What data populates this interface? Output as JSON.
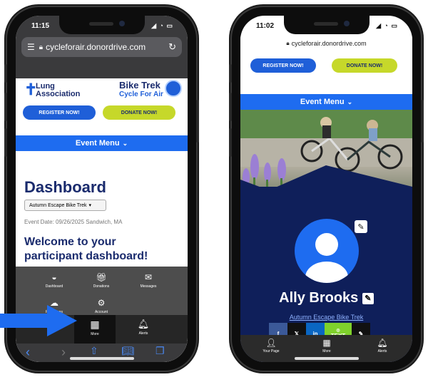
{
  "left_phone": {
    "status": {
      "time": "11:15",
      "icons": "▲ ◆ ▭"
    },
    "address_bar": {
      "host": "cycleforair.donordrive.com",
      "tab_icon": "tabs-icon",
      "reload_icon": "reload-icon"
    },
    "logo_left": {
      "line1": "Lung",
      "line2": "Association"
    },
    "logo_right": {
      "title": "Bike Trek",
      "subtitle": "Cycle For Air"
    },
    "buttons": {
      "register": "REGISTER NOW!",
      "donate": "DONATE NOW!"
    },
    "event_menu": "Event Menu",
    "dashboard": {
      "title": "Dashboard",
      "event_select": "Autumn Escape Bike Trek",
      "date_line": "Event Date: 09/26/2025  Sandwich, MA",
      "welcome": "Welcome to your participant dashboard!"
    },
    "more_menu": [
      {
        "label": "Dashboard",
        "icon": "speedometer-icon"
      },
      {
        "label": "Donations",
        "icon": "gift-icon"
      },
      {
        "label": "Messages",
        "icon": "envelope-icon"
      },
      {
        "label": "Resources",
        "icon": "cloud-icon"
      },
      {
        "label": "Account",
        "icon": "gear-icon"
      }
    ],
    "tab_more": "More",
    "tab_alerts": "Alerts"
  },
  "right_phone": {
    "status": {
      "time": "11:02"
    },
    "address": "cycleforair.donordrive.com",
    "buttons": {
      "register": "REGISTER NOW!",
      "donate": "DONATE NOW!"
    },
    "event_menu": "Event Menu",
    "profile_name": "Ally Brooks",
    "event_link": "Autumn Escape Bike Trek",
    "share": [
      {
        "label": "f",
        "color": "#3b5998"
      },
      {
        "label": "𝕏",
        "color": "#111111"
      },
      {
        "label": "in",
        "color": "#0a66c2"
      },
      {
        "label": "TEXT",
        "color": "#7fd12c"
      },
      {
        "label": "✎",
        "color": "#111111"
      }
    ],
    "tabs": [
      {
        "label": "Your Page",
        "icon": "person-icon"
      },
      {
        "label": "More",
        "icon": "grid-icon"
      },
      {
        "label": "Alerts",
        "icon": "bell-icon"
      }
    ]
  },
  "colors": {
    "brand_blue": "#1e6cf0",
    "navy": "#0f1f5a",
    "lime": "#c6d82a",
    "callout_arrow": "#1e6cf0"
  }
}
